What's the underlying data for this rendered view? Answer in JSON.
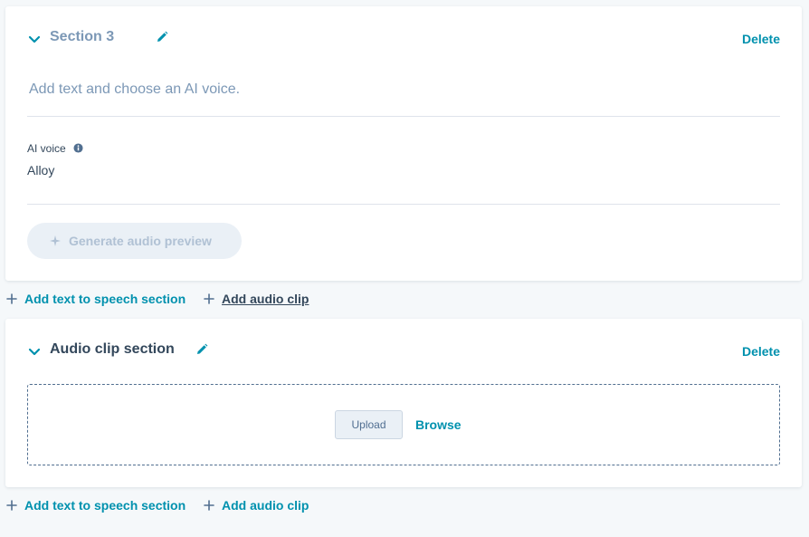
{
  "sections": [
    {
      "title": "Section 3",
      "delete_label": "Delete",
      "text_placeholder": "Add text and choose an AI voice.",
      "voice_label": "AI voice",
      "voice_value": "Alloy",
      "generate_label": "Generate audio preview"
    },
    {
      "title": "Audio clip section",
      "delete_label": "Delete",
      "upload_label": "Upload",
      "browse_label": "Browse"
    }
  ],
  "add_actions": {
    "add_tts_label": "Add text to speech section",
    "add_clip_label": "Add audio clip"
  },
  "icons": {
    "collapse": "chevron-down-icon",
    "edit": "pencil-icon",
    "info": "info-icon",
    "sparkle": "sparkle-icon",
    "plus": "plus-icon"
  },
  "colors": {
    "accent": "#0091ae",
    "text": "#33475b",
    "muted": "#7c98b6",
    "disabled_bg": "#eaf0f6",
    "page_bg": "#f5f8fa"
  }
}
